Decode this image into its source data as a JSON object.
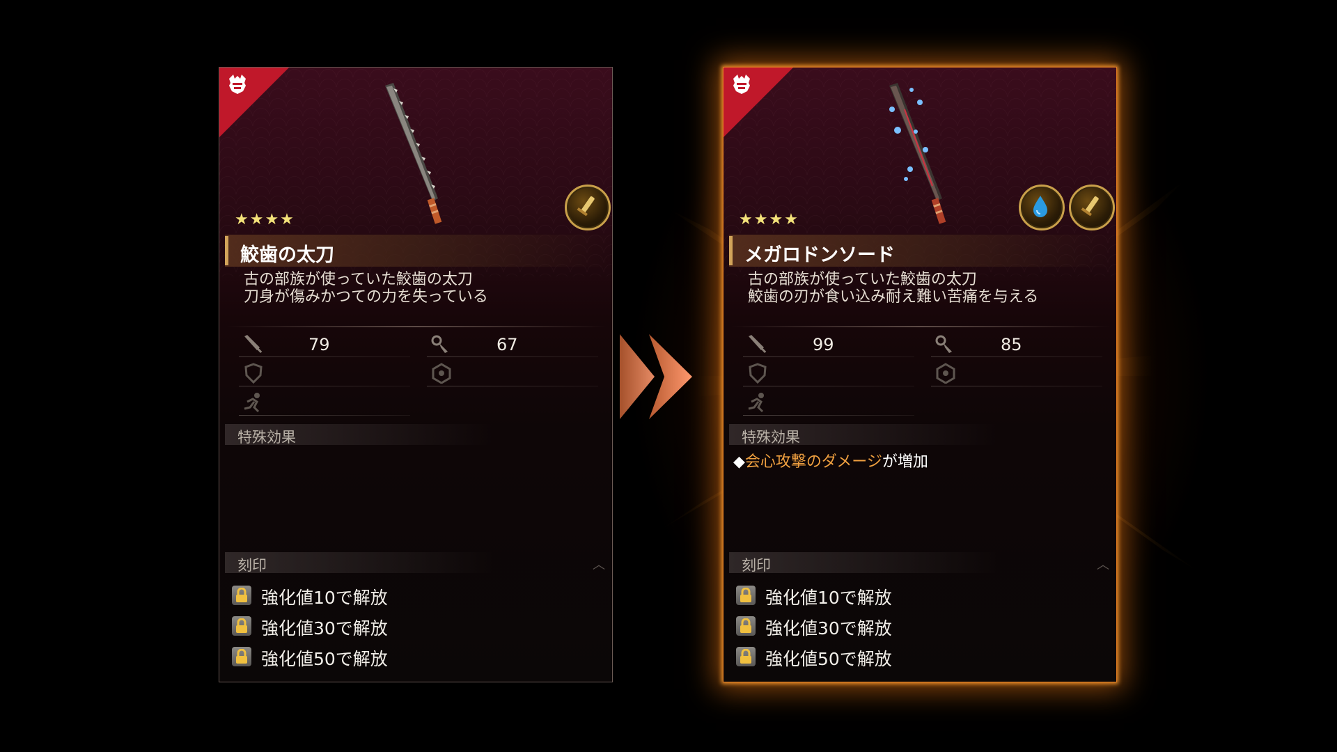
{
  "comparison": {
    "before": {
      "stars": "★★★★",
      "name": "鮫歯の太刀",
      "description": "古の部族が使っていた鮫歯の太刀\n刀身が傷みかつての力を失っている",
      "attack": "79",
      "affinity": "67",
      "special_label": "特殊効果",
      "special_effect": "",
      "engrave_label": "刻印",
      "engravings": [
        "強化値10で解放",
        "強化値30で解放",
        "強化値50で解放"
      ],
      "badges": [
        "sword-badge-icon"
      ]
    },
    "after": {
      "stars": "★★★★",
      "name": "メガロドンソード",
      "description": "古の部族が使っていた鮫歯の太刀\n鮫歯の刃が食い込み耐え難い苦痛を与える",
      "attack": "99",
      "affinity": "85",
      "special_label": "特殊効果",
      "special_effect_prefix": "◆",
      "special_effect_highlight": "会心攻撃のダメージ",
      "special_effect_suffix": "が増加",
      "engrave_label": "刻印",
      "engravings": [
        "強化値10で解放",
        "強化値30で解放",
        "強化値50で解放"
      ],
      "badges": [
        "water-element-icon",
        "sword-badge-icon"
      ]
    }
  },
  "colors": {
    "accent_glow": "#ff8c14",
    "corner_red": "#c0182a",
    "highlight_text": "#f0a040",
    "star": "#f3e27a"
  }
}
